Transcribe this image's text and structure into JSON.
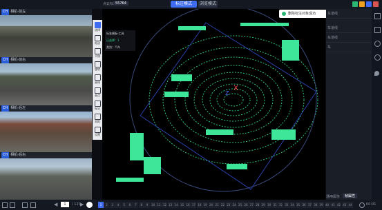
{
  "topbar": {
    "left_label": "点云标注",
    "id_label": "55764",
    "mode_active": "标注模式",
    "mode_inactive": "浏览模式",
    "right_colors": [
      "#2bb673",
      "#f0a020",
      "#3d6cf0",
      "#d9534f"
    ]
  },
  "toast": {
    "message": "删除标注对象成功"
  },
  "cameras": [
    {
      "tag": "CH",
      "name": "相机-前左"
    },
    {
      "tag": "CH",
      "name": "相机-前右"
    },
    {
      "tag": "CH",
      "name": "相机-后左"
    },
    {
      "tag": "CH",
      "name": "相机-后右"
    }
  ],
  "tools": [
    {
      "label": "选择",
      "active": true
    },
    {
      "label": "框选"
    },
    {
      "label": "平移"
    },
    {
      "label": "旋转"
    },
    {
      "label": "画线"
    },
    {
      "label": "画点"
    },
    {
      "label": "标记"
    },
    {
      "label": "测距"
    },
    {
      "label": "设置"
    }
  ],
  "infobox": {
    "title": "标准模板-工具",
    "line1": "已选择：1",
    "line2": "类别：汽车"
  },
  "right_panel": {
    "items": [
      "车道线",
      "车道线",
      "车道线",
      "车"
    ],
    "bottom_tabs": [
      "通用属性",
      "帧属性"
    ]
  },
  "bottom": {
    "page": "1",
    "total": "/ 120",
    "frames": [
      "1",
      "2",
      "3",
      "4",
      "5",
      "6",
      "7",
      "8",
      "9",
      "10",
      "11",
      "12",
      "13",
      "14",
      "15",
      "16",
      "17",
      "18",
      "19",
      "20",
      "21",
      "22",
      "23",
      "24",
      "25",
      "26",
      "27",
      "28",
      "29",
      "30",
      "31",
      "32",
      "33",
      "34",
      "35",
      "36",
      "37",
      "38",
      "39",
      "40",
      "41",
      "42",
      "43",
      "44"
    ],
    "time": "00:01"
  }
}
